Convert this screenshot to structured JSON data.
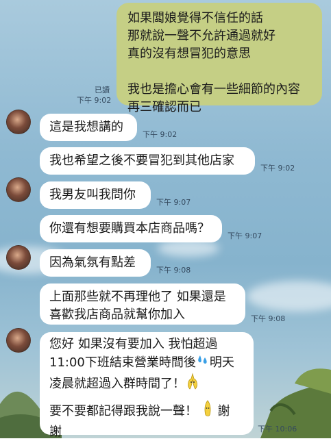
{
  "outgoing": {
    "lines": [
      "如果闆娘覺得不信任的話",
      "那就說一聲不允許通過就好",
      "真的沒有想冒犯的意思",
      "",
      "我也是擔心會有一些細節的內容",
      "再三確認而已"
    ],
    "read_label": "已讀",
    "time": "下午 9:02"
  },
  "incoming": [
    {
      "text": "這是我想講的",
      "time": "下午 9:02"
    },
    {
      "text": "我也希望之後不要冒犯到其他店家",
      "time": "下午 9:02"
    },
    {
      "text": "我男友叫我問你",
      "time": "下午 9:07"
    },
    {
      "text": "你還有想要購買本店商品嗎？",
      "time": "下午 9:07"
    },
    {
      "text": "因為氣氛有點差",
      "time": "下午 9:08"
    },
    {
      "lines": [
        "上面那些就不再理他了 如果還是",
        "喜歡我店商品就幫你加入"
      ],
      "time": "下午 9:08"
    },
    {
      "lines": [
        "您好 如果沒有要加入 我怕超過",
        "11:00下班結束營業時間後",
        "明天",
        "凌晨就超過入群時間了！",
        "要不要都記得跟我說一聲！",
        "謝",
        "謝"
      ],
      "time": "下午 10:06"
    }
  ],
  "icons": [
    "avatar-image",
    "sweat-droplets-icon",
    "banana-icon",
    "banana-icon"
  ]
}
